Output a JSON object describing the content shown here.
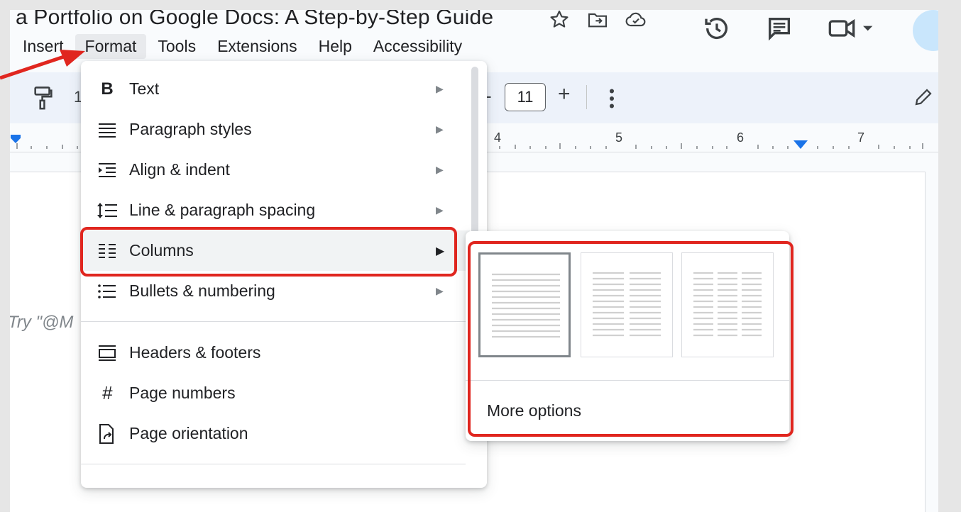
{
  "doc": {
    "title": "a Portfolio on Google Docs: A Step-by-Step Guide",
    "placeholder": "Try \"@M"
  },
  "menubar": {
    "items": [
      "Insert",
      "Format",
      "Tools",
      "Extensions",
      "Help",
      "Accessibility"
    ],
    "active": "Format"
  },
  "toolbar": {
    "font_size": "11",
    "partial_label": "1"
  },
  "ruler": {
    "numbers": [
      "4",
      "5",
      "6",
      "7"
    ]
  },
  "format_menu": {
    "items": [
      {
        "label": "Text",
        "icon": "bold-icon",
        "has_submenu": true
      },
      {
        "label": "Paragraph styles",
        "icon": "paragraph-styles-icon",
        "has_submenu": true
      },
      {
        "label": "Align & indent",
        "icon": "indent-icon",
        "has_submenu": true
      },
      {
        "label": "Line & paragraph spacing",
        "icon": "line-spacing-icon",
        "has_submenu": true
      },
      {
        "label": "Columns",
        "icon": "columns-icon",
        "has_submenu": true
      },
      {
        "label": "Bullets & numbering",
        "icon": "bulleted-list-icon",
        "has_submenu": true
      },
      {
        "label": "Headers & footers",
        "icon": "header-footer-icon",
        "has_submenu": false
      },
      {
        "label": "Page numbers",
        "icon": "hash-icon",
        "has_submenu": false
      },
      {
        "label": "Page orientation",
        "icon": "page-orientation-icon",
        "has_submenu": false
      }
    ],
    "hovered": "Columns"
  },
  "columns_submenu": {
    "options": [
      {
        "columns": 1,
        "selected": true
      },
      {
        "columns": 2,
        "selected": false
      },
      {
        "columns": 3,
        "selected": false
      }
    ],
    "more_options": "More options"
  },
  "colors": {
    "annotation_red": "#e0261f",
    "toolbar_bg": "#edf2fa",
    "ruler_marker_blue": "#1a73e8"
  }
}
